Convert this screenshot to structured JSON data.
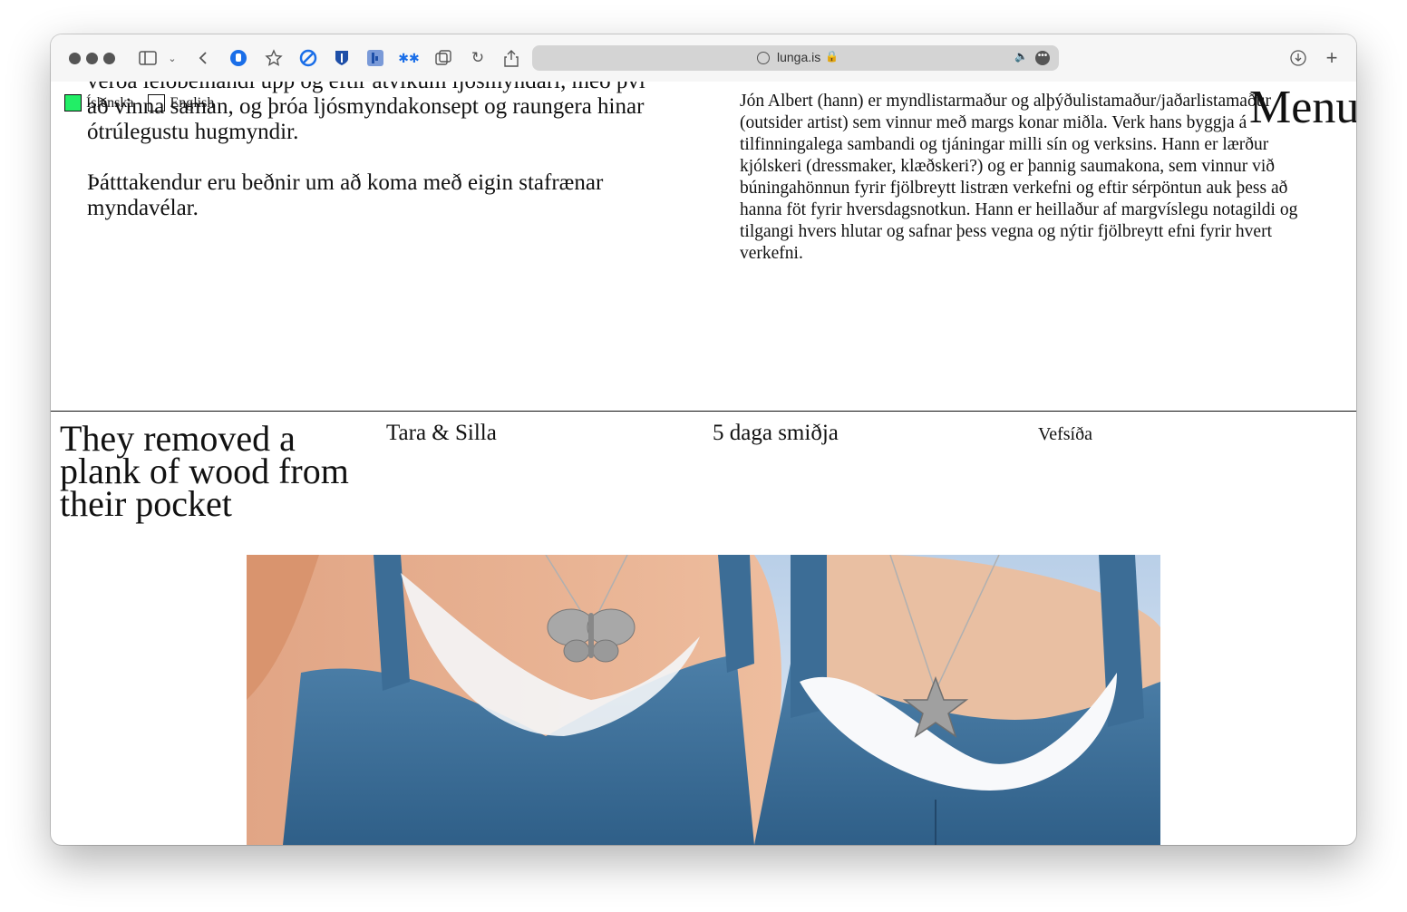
{
  "browser": {
    "url": "lunga.is"
  },
  "page": {
    "intro_paragraphs": [
      "verða leiðbeinandi upp og eftir atvikum ljósmyndari, með því að vinna saman, og þróa ljósmyndakonsept og raungera hinar ótrúlegustu hugmyndir.",
      "Þátttakendur eru beðnir um að koma með eigin stafrænar myndavélar."
    ],
    "bio": "Jón Albert (hann) er myndlistarmaður og alþýðulistamaður/jaðarlistamaður (outsider artist) sem vinnur með margs konar miðla. Verk hans byggja á tilfinningalega sambandi og tjáningar milli sín og verksins. Hann er lærður kjólskeri (dressmaker, klæðskeri?) og er þannig saumakona, sem vinnur við búningahönnun fyrir fjölbreytt listræn verkefni og eftir sérpöntun auk þess að hanna föt fyrir hversdagsnotkun. Hann er heillaður af margvíslegu notagildi og tilgangi hvers hlutar og safnar þess vegna og nýtir fjölbreytt efni fyrir hvert verkefni.",
    "languages": [
      {
        "label": "Íslenska",
        "checked": true
      },
      {
        "label": "English",
        "checked": false
      }
    ],
    "menu_label": "Menu",
    "card": {
      "title": "They removed a plank of wood from their pocket",
      "artists": "Tara & Silla",
      "type": "5 daga smiðja",
      "link": "Vefsíða"
    },
    "colors": {
      "lang_active": "#22ee66",
      "text": "#111111"
    }
  }
}
